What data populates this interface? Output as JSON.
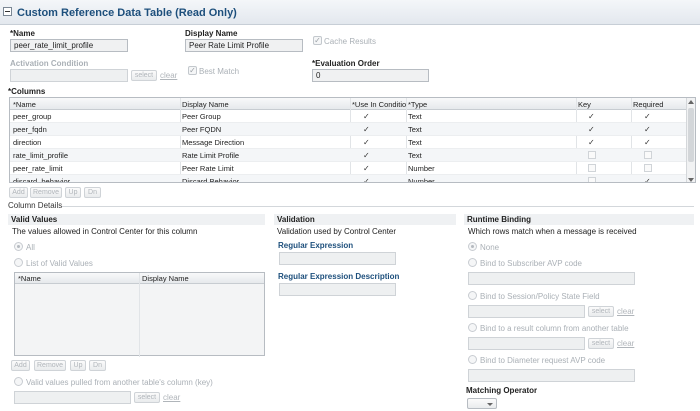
{
  "title": "Custom Reference Data Table (Read Only)",
  "fields": {
    "name_label": "*Name",
    "name_value": "peer_rate_limit_profile",
    "display_name_label": "Display Name",
    "display_name_value": "Peer Rate Limit Profile",
    "cache_results_label": "Cache Results",
    "activation_condition_label": "Activation Condition",
    "activation_select": "select",
    "activation_clear": "clear",
    "best_match_label": "Best Match",
    "evaluation_order_label": "*Evaluation Order",
    "evaluation_order_value": "0"
  },
  "columns": {
    "label": "*Columns",
    "headers": [
      "*Name",
      "Display Name",
      "*Use In Conditio",
      "*Type",
      "Key",
      "Required"
    ],
    "rows": [
      {
        "name": "peer_group",
        "display": "Peer Group",
        "use": true,
        "type": "Text",
        "key": true,
        "required": true
      },
      {
        "name": "peer_fqdn",
        "display": "Peer FQDN",
        "use": true,
        "type": "Text",
        "key": true,
        "required": true
      },
      {
        "name": "direction",
        "display": "Message Direction",
        "use": true,
        "type": "Text",
        "key": true,
        "required": true
      },
      {
        "name": "rate_limit_profile",
        "display": "Rate Limit Profile",
        "use": true,
        "type": "Text",
        "key": false,
        "required": false
      },
      {
        "name": "peer_rate_limit",
        "display": "Peer Rate Limit",
        "use": true,
        "type": "Number",
        "key": false,
        "required": false
      },
      {
        "name": "discard_behavior",
        "display": "Discard Behavior",
        "use": true,
        "type": "Number",
        "key": false,
        "required": true
      }
    ],
    "buttons": [
      "Add",
      "Remove",
      "Up",
      "Dn"
    ]
  },
  "column_details": {
    "label": "Column Details",
    "valid_values": {
      "heading": "Valid Values",
      "description": "The values allowed in Control Center for this column",
      "all_label": "All",
      "list_label": "List of Valid Values",
      "list_headers": [
        "*Name",
        "Display Name"
      ],
      "buttons": [
        "Add",
        "Remove",
        "Up",
        "Dn"
      ],
      "pulled_label": "Valid values pulled from another table's column (key)",
      "select": "select",
      "clear": "clear"
    },
    "validation": {
      "heading": "Validation",
      "description": "Validation used by Control Center",
      "regex_label": "Regular Expression",
      "regex_desc_label": "Regular Expression Description"
    },
    "runtime_binding": {
      "heading": "Runtime Binding",
      "description": "Which rows match when a message is received",
      "options": [
        "None",
        "Bind to Subscriber AVP code",
        "Bind to Session/Policy State Field",
        "Bind to a result column from another table",
        "Bind to Diameter request AVP code"
      ],
      "select": "select",
      "clear": "clear",
      "matching_operator_label": "Matching Operator"
    }
  }
}
